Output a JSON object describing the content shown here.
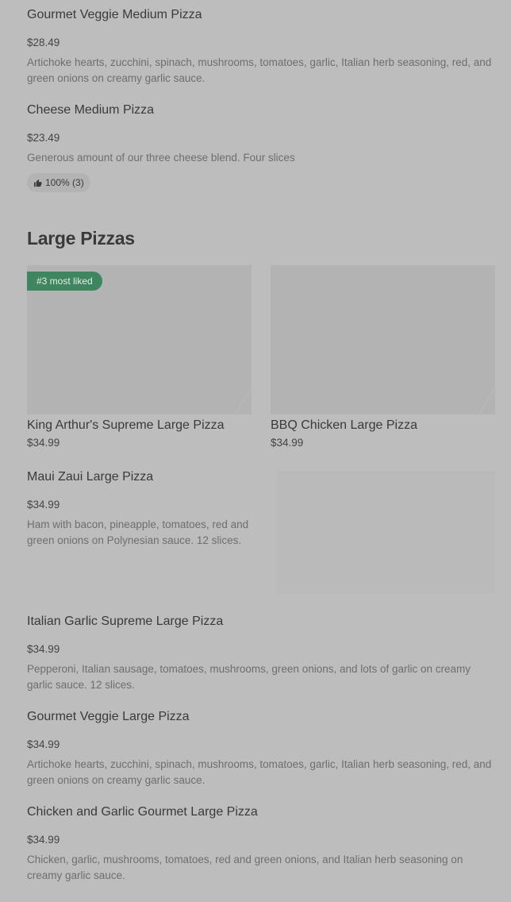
{
  "items_top": [
    {
      "title": "Gourmet Veggie Medium Pizza",
      "price": "$28.49",
      "description": "Artichoke hearts, zucchini, spinach, mushrooms, tomatoes, garlic, Italian herb seasoning, red, and green onions on creamy garlic sauce."
    },
    {
      "title": "Cheese Medium Pizza",
      "price": "$23.49",
      "description": "Generous amount of our three cheese blend. Four slices",
      "rating": "100% (3)",
      "rating_icon": "thumbs-up-icon"
    }
  ],
  "section": {
    "title": "Large Pizzas"
  },
  "cards": [
    {
      "badge": "#3 most liked",
      "title": "King Arthur's Supreme Large Pizza",
      "price": "$34.99"
    },
    {
      "title": "BBQ Chicken Large Pizza",
      "price": "$34.99"
    }
  ],
  "items_bottom": [
    {
      "title": "Maui Zaui Large Pizza",
      "price": "$34.99",
      "description": "Ham with bacon, pineapple, tomatoes, red and green onions on Polynesian sauce. 12 slices."
    },
    {
      "title": "Italian Garlic Supreme Large Pizza",
      "price": "$34.99",
      "description": "Pepperoni, Italian sausage, tomatoes, mushrooms, green onions, and lots of garlic on creamy garlic sauce. 12 slices."
    },
    {
      "title": "Gourmet Veggie Large Pizza",
      "price": "$34.99",
      "description": "Artichoke hearts, zucchini, spinach, mushrooms, tomatoes, garlic, Italian herb seasoning, red, and green onions on creamy garlic sauce."
    },
    {
      "title": "Chicken and Garlic Gourmet Large Pizza",
      "price": "$34.99",
      "description": "Chicken, garlic, mushrooms, tomatoes, red and green onions, and Italian herb seasoning on creamy garlic sauce."
    }
  ],
  "colors": {
    "overlay_background": "#bdbdbd",
    "badge_green": "#3f8560"
  }
}
